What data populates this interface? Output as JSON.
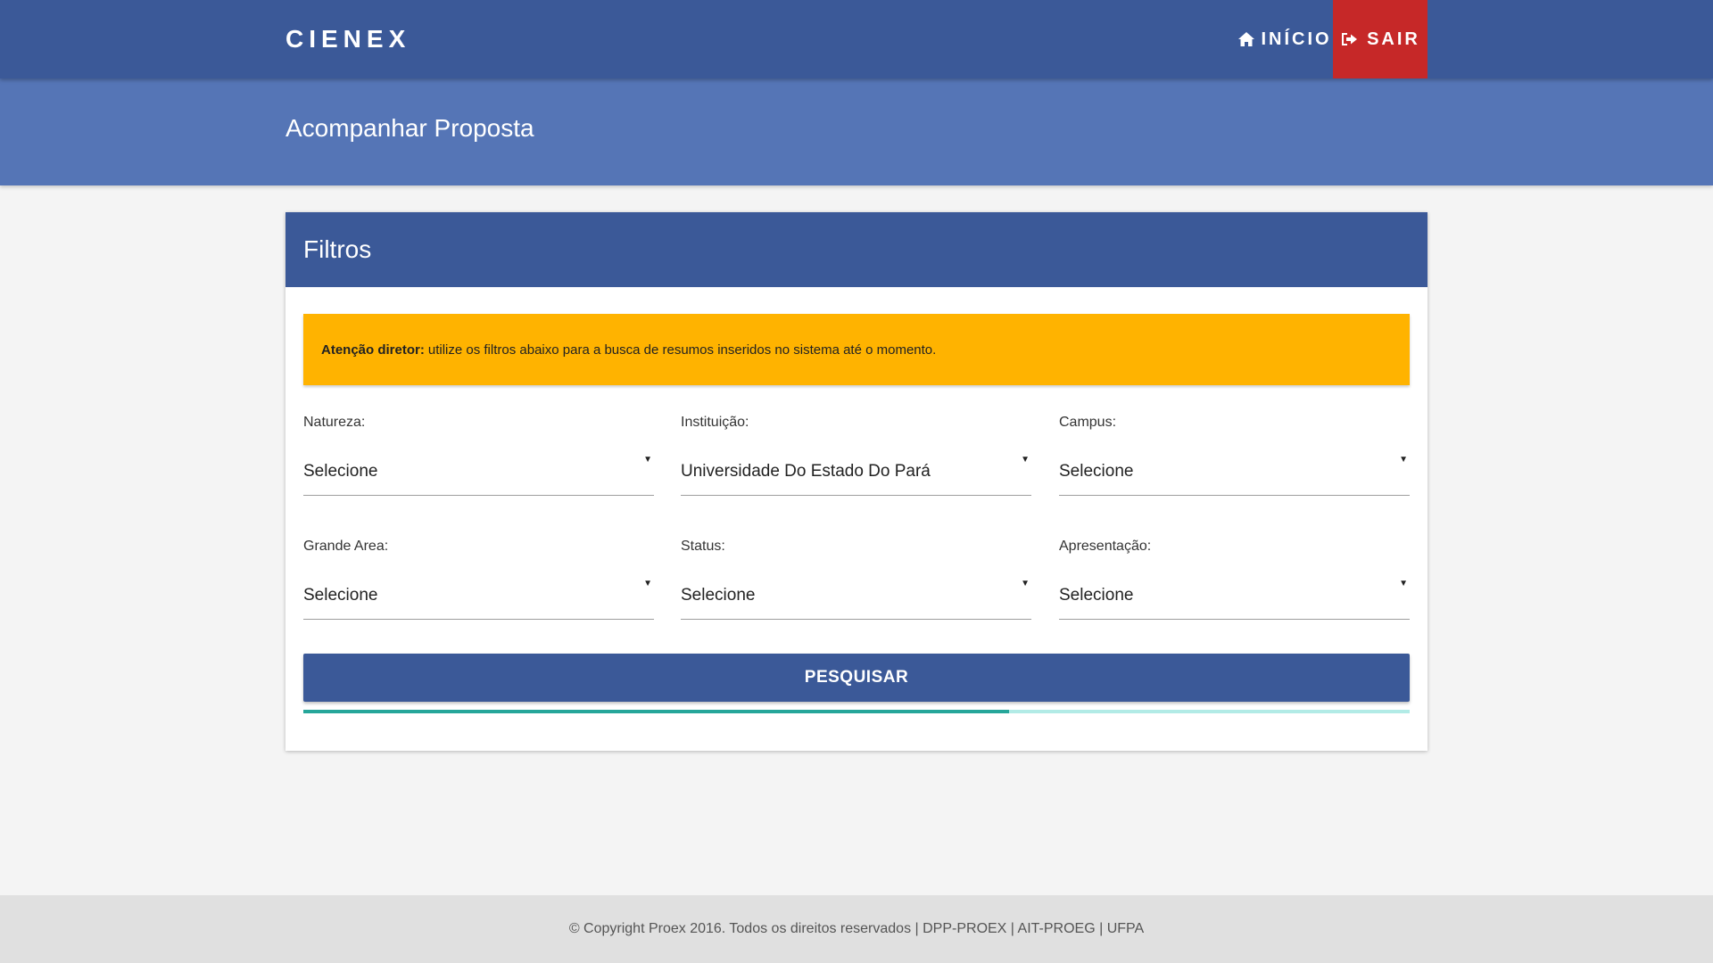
{
  "navbar": {
    "brand": "CIENEX",
    "links": [
      {
        "label": "INÍCIO",
        "icon": "home-icon"
      },
      {
        "label": "SAIR",
        "icon": "sign-out-icon"
      }
    ],
    "colors": {
      "bar": "#3b5998",
      "logout": "#c62828"
    }
  },
  "page": {
    "title": "Acompanhar Proposta",
    "header_color": "#5575b6"
  },
  "card": {
    "title": "Filtros",
    "alert": {
      "strong": "Atenção diretor:",
      "text": "utilize os filtros abaixo para a busca de resumos inseridos no sistema até o momento.",
      "color": "#ffb300"
    },
    "filters": [
      {
        "label": "Natureza:",
        "value": "Selecione"
      },
      {
        "label": "Instituição:",
        "value": "Universidade Do Estado Do Pará"
      },
      {
        "label": "Campus:",
        "value": "Selecione"
      },
      {
        "label": "Grande Area:",
        "value": "Selecione"
      },
      {
        "label": "Status:",
        "value": "Selecione"
      },
      {
        "label": "Apresentação:",
        "value": "Selecione"
      }
    ],
    "caret": "▼",
    "search_label": "PESQUISAR",
    "progress": 0.638
  },
  "footer": {
    "text": "© Copyright Proex 2016. Todos os direitos reservados | DPP-PROEX | AIT-PROEG | UFPA"
  }
}
